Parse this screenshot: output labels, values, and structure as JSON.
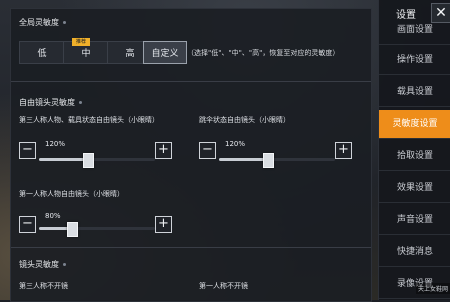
{
  "global": {
    "title": "全局灵敏度",
    "options": [
      "低",
      "中",
      "高",
      "自定义"
    ],
    "selected": "自定义",
    "recommend_badge": "推荐",
    "hint": "（选择\"低\"、\"中\"、\"高\"，恢复至对应的灵敏度）"
  },
  "free_look": {
    "title": "自由镜头灵敏度",
    "sliders": [
      {
        "label": "第三人称人物、载具状态自由镜头（小眼睛）",
        "value_text": "120%",
        "fraction": 0.42
      },
      {
        "label": "跳伞状态自由镜头（小眼睛）",
        "value_text": "120%",
        "fraction": 0.42
      },
      {
        "label": "第一人称人物自由镜头（小眼睛）",
        "value_text": "80%",
        "fraction": 0.28
      }
    ],
    "minus": "−",
    "plus": "+"
  },
  "camera": {
    "title": "镜头灵敏度",
    "left_label": "第三人称不开镜",
    "right_label": "第一人称不开镜"
  },
  "sidebar": {
    "title": "设置",
    "close": "✕",
    "items": [
      {
        "label": "画面设置"
      },
      {
        "label": "操作设置"
      },
      {
        "label": "载具设置"
      },
      {
        "label": "灵敏度设置"
      },
      {
        "label": "拾取设置"
      },
      {
        "label": "效果设置"
      },
      {
        "label": "声音设置"
      },
      {
        "label": "快捷消息"
      },
      {
        "label": "录像设置"
      }
    ],
    "active": "灵敏度设置"
  },
  "watermark": "天上女鞋网",
  "colors": {
    "accent": "#ee8d1a",
    "badge": "#f0b02a"
  }
}
